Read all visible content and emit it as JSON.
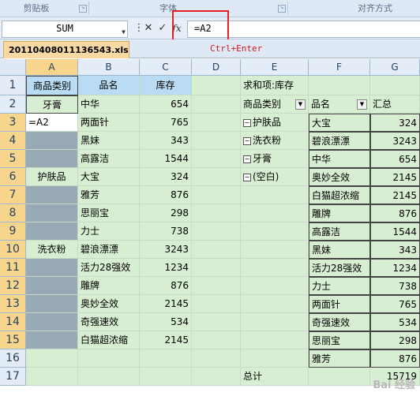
{
  "ribbon": {
    "groups": [
      "剪贴板",
      "字体",
      "对齐方式"
    ]
  },
  "formula_bar": {
    "name_box": "SUM",
    "cancel_icon": "✕",
    "enter_icon": "✓",
    "fx_label": "fx",
    "formula": "=A2"
  },
  "workbook": {
    "tab_name": "20110408011136543.xls",
    "hint": "Ctrl+Enter"
  },
  "columns": [
    "A",
    "B",
    "C",
    "D",
    "E",
    "F",
    "G"
  ],
  "rows": [
    "1",
    "2",
    "3",
    "4",
    "5",
    "6",
    "7",
    "8",
    "9",
    "10",
    "11",
    "12",
    "13",
    "14",
    "15",
    "16",
    "17"
  ],
  "source_table": {
    "headers": [
      "商品类别",
      "品名",
      "库存"
    ],
    "a_values": [
      "牙膏",
      "=A2",
      "",
      "",
      "护肤品",
      "",
      "",
      "",
      "洗衣粉",
      "",
      "",
      "",
      "",
      ""
    ],
    "items": [
      {
        "name": "中华",
        "stock": "654"
      },
      {
        "name": "两面针",
        "stock": "765"
      },
      {
        "name": "黑妹",
        "stock": "343"
      },
      {
        "name": "高露洁",
        "stock": "1544"
      },
      {
        "name": "大宝",
        "stock": "324"
      },
      {
        "name": "雅芳",
        "stock": "876"
      },
      {
        "name": "思丽宝",
        "stock": "298"
      },
      {
        "name": "力士",
        "stock": "738"
      },
      {
        "name": "碧浪漂漂",
        "stock": "3243"
      },
      {
        "name": "活力28强效",
        "stock": "1234"
      },
      {
        "name": "雕牌",
        "stock": "876"
      },
      {
        "name": "奥妙全效",
        "stock": "2145"
      },
      {
        "name": "奇强速效",
        "stock": "534"
      },
      {
        "name": "白猫超浓缩",
        "stock": "2145"
      }
    ]
  },
  "pivot": {
    "title": "求和项:库存",
    "headers": [
      "商品类别",
      "品名",
      "汇总"
    ],
    "groups": [
      "护肤品",
      "洗衣粉",
      "牙膏",
      "(空白)"
    ],
    "rows": [
      {
        "name": "大宝",
        "total": "324"
      },
      {
        "name": "碧浪漂漂",
        "total": "3243"
      },
      {
        "name": "中华",
        "total": "654"
      },
      {
        "name": "奥妙全效",
        "total": "2145"
      },
      {
        "name": "白猫超浓缩",
        "total": "2145"
      },
      {
        "name": "雕牌",
        "total": "876"
      },
      {
        "name": "高露洁",
        "total": "1544"
      },
      {
        "name": "黑妹",
        "total": "343"
      },
      {
        "name": "活力28强效",
        "total": "1234"
      },
      {
        "name": "力士",
        "total": "738"
      },
      {
        "name": "两面针",
        "total": "765"
      },
      {
        "name": "奇强速效",
        "total": "534"
      },
      {
        "name": "思丽宝",
        "total": "298"
      },
      {
        "name": "雅芳",
        "total": "876"
      }
    ],
    "grand_total_label": "总计",
    "grand_total": "15719"
  },
  "watermark": "Bai 经验"
}
